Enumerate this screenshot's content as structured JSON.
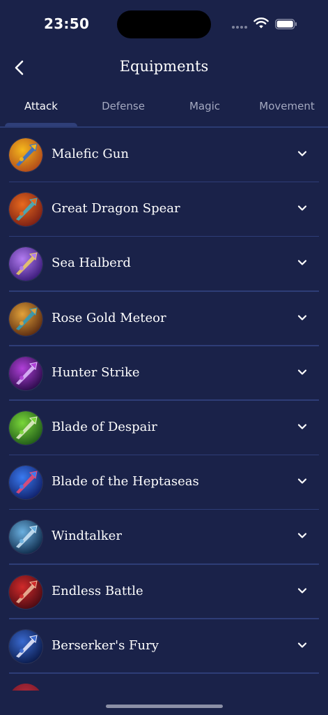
{
  "status_bar": {
    "time": "23:50"
  },
  "nav": {
    "title": "Equipments"
  },
  "tabs": [
    {
      "label": "Attack",
      "active": true
    },
    {
      "label": "Defense",
      "active": false
    },
    {
      "label": "Magic",
      "active": false
    },
    {
      "label": "Movement",
      "active": false
    }
  ],
  "items": [
    {
      "name": "Malefic Gun",
      "icon": "malefic-gun-icon",
      "colors": [
        "#f5b81c",
        "#b0481a",
        "#2a6fd6"
      ]
    },
    {
      "name": "Great Dragon Spear",
      "icon": "great-dragon-spear-icon",
      "colors": [
        "#e86a1e",
        "#7a1e14",
        "#3bb4c8"
      ]
    },
    {
      "name": "Sea Halberd",
      "icon": "sea-halberd-icon",
      "colors": [
        "#b27cf0",
        "#3a1a7a",
        "#f0d060"
      ]
    },
    {
      "name": "Rose Gold Meteor",
      "icon": "rose-gold-meteor-icon",
      "colors": [
        "#e2a23a",
        "#5a2a10",
        "#2a9ec0"
      ]
    },
    {
      "name": "Hunter Strike",
      "icon": "hunter-strike-icon",
      "colors": [
        "#b040d8",
        "#2a0a4a",
        "#e0c0ff"
      ]
    },
    {
      "name": "Blade of Despair",
      "icon": "blade-of-despair-icon",
      "colors": [
        "#7ad63a",
        "#1f5a18",
        "#e8f0d0"
      ]
    },
    {
      "name": "Blade of the Heptaseas",
      "icon": "blade-of-the-heptaseas-icon",
      "colors": [
        "#3a7af0",
        "#10206a",
        "#f04a70"
      ]
    },
    {
      "name": "Windtalker",
      "icon": "windtalker-icon",
      "colors": [
        "#6ab0e0",
        "#0e2a4a",
        "#d0e8f8"
      ]
    },
    {
      "name": "Endless Battle",
      "icon": "endless-battle-icon",
      "colors": [
        "#d02a2a",
        "#4a0a12",
        "#f0c0a0"
      ]
    },
    {
      "name": "Berserker's Fury",
      "icon": "berserkers-fury-icon",
      "colors": [
        "#3a6ad0",
        "#0a1a4a",
        "#f0f0ff"
      ]
    }
  ],
  "theme": {
    "background": "#1a2249",
    "divider": "#2e3d77",
    "tab_inactive": "#a4a9c0"
  }
}
